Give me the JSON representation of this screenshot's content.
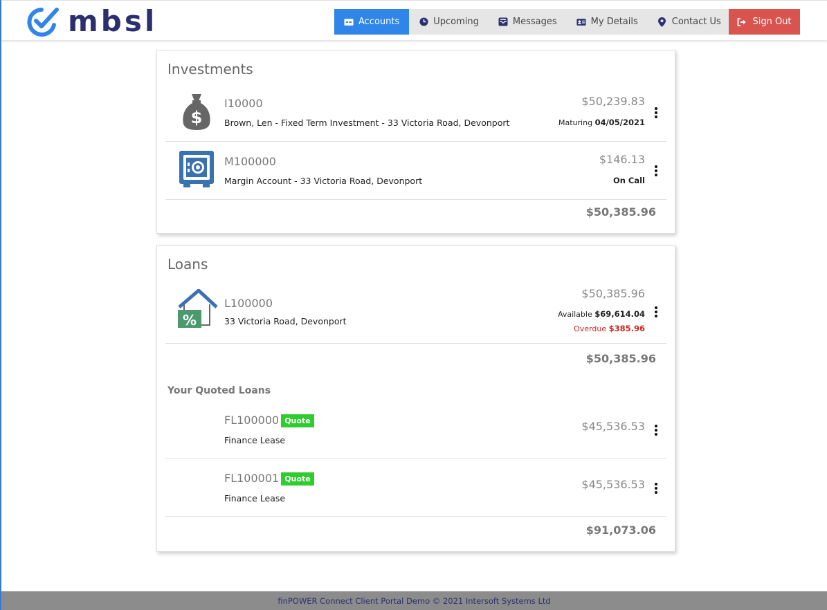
{
  "brand": {
    "name": "mbsl"
  },
  "nav": {
    "items": [
      {
        "label": "Accounts",
        "icon": "card-icon",
        "active": true
      },
      {
        "label": "Upcoming",
        "icon": "clock-icon"
      },
      {
        "label": "Messages",
        "icon": "inbox-icon"
      },
      {
        "label": "My Details",
        "icon": "id-card-icon"
      },
      {
        "label": "Contact Us",
        "icon": "map-marker-icon"
      }
    ],
    "signout": "Sign Out"
  },
  "investments": {
    "title": "Investments",
    "rows": [
      {
        "code": "I10000",
        "desc": "Brown, Len - Fixed Term Investment - 33 Victoria Road, Devonport",
        "amount": "$50,239.83",
        "sub_label": "Maturing",
        "sub_value": "04/05/2021",
        "icon": "money-bag-icon"
      },
      {
        "code": "M100000",
        "desc": "Margin Account - 33 Victoria Road, Devonport",
        "amount": "$146.13",
        "sub_label": "",
        "sub_value": "On Call",
        "icon": "safe-icon"
      }
    ],
    "total": "$50,385.96"
  },
  "loans": {
    "title": "Loans",
    "rows": [
      {
        "code": "L100000",
        "desc": "33 Victoria Road, Devonport",
        "amount": "$50,385.96",
        "available_label": "Available",
        "available_value": "$69,614.04",
        "overdue_label": "Overdue",
        "overdue_value": "$385.96",
        "icon": "house-percent-icon"
      }
    ],
    "total": "$50,385.96",
    "quoted_title": "Your Quoted Loans",
    "quoted": [
      {
        "code": "FL100000",
        "badge": "Quote",
        "desc": "Finance Lease",
        "amount": "$45,536.53"
      },
      {
        "code": "FL100001",
        "badge": "Quote",
        "desc": "Finance Lease",
        "amount": "$45,536.53"
      }
    ],
    "quoted_total": "$91,073.06"
  },
  "colors": {
    "accent": "#2f86e8",
    "danger": "#d9534f",
    "quote": "#2ecc2e",
    "brand": "#2b2f6e"
  },
  "footer": "finPOWER Connect Client Portal Demo © 2021 Intersoft Systems Ltd"
}
